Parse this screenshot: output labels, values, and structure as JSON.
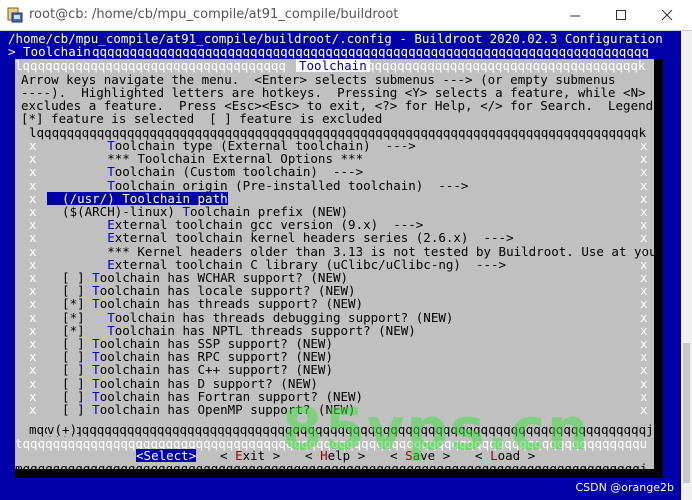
{
  "window": {
    "title": "root@cb: /home/cb/mpu_compile/at91_compile/buildroot",
    "icons": [
      "terminal-app-icon",
      "minimize-icon",
      "maximize-icon",
      "close-icon"
    ]
  },
  "terminal": {
    "header_line1": "/home/cb/mpu_compile/at91_compile/buildroot/.config - Buildroot 2020.02.3 Configuration",
    "breadcrumb": "> Toolchain",
    "dialog_title": "Toolchain",
    "help_lines": [
      "Arrow keys navigate the menu.  <Enter> selects submenus ---> (or empty submenus",
      "----).  Highlighted letters are hotkeys.  Pressing <Y> selects a feature, while <N>",
      "excludes a feature.  Press <Esc><Esc> to exit, <?> for Help, </> for Search.  Legend:",
      "[*] feature is selected  [ ] feature is excluded"
    ],
    "menu_items": [
      {
        "prefix": "        ",
        "hot": "T",
        "rest": "oolchain type (External toolchain)  --->"
      },
      {
        "prefix": "        ",
        "hot": "",
        "rest": "*** Toolchain External Options ***"
      },
      {
        "prefix": "        ",
        "hot": "T",
        "rest": "oolchain (Custom toolchain)  --->"
      },
      {
        "prefix": "        ",
        "hot": "T",
        "rest": "oolchain origin (Pre-installed toolchain)  --->"
      },
      {
        "prefix": "  (",
        "hot": "/",
        "rest": "usr/) Toolchain path"
      },
      {
        "prefix": "  ($(ARCH)-linux) ",
        "hot": "T",
        "rest": "oolchain prefix (NEW)"
      },
      {
        "prefix": "        ",
        "hot": "E",
        "rest": "xternal toolchain gcc version (9.x)  --->"
      },
      {
        "prefix": "        ",
        "hot": "E",
        "rest": "xternal toolchain kernel headers series (2.6.x)  --->"
      },
      {
        "prefix": "        ",
        "hot": "",
        "rest": "*** Kernel headers older than 3.13 is not tested by Buildroot. Use at you"
      },
      {
        "prefix": "        ",
        "hot": "E",
        "rest": "xternal toolchain C library (uClibc/uClibc-ng)  --->"
      },
      {
        "prefix": "  [ ] ",
        "hot": "T",
        "rest": "oolchain has WCHAR support? (NEW)"
      },
      {
        "prefix": "  [ ] ",
        "hot": "T",
        "rest": "oolchain has locale support? (NEW)"
      },
      {
        "prefix": "  [*] ",
        "hot": "T",
        "rest": "oolchain has threads support? (NEW)"
      },
      {
        "prefix": "  [*]   ",
        "hot": "T",
        "rest": "oolchain has threads debugging support? (NEW)"
      },
      {
        "prefix": "  [*]   ",
        "hot": "T",
        "rest": "oolchain has NPTL threads support? (NEW)"
      },
      {
        "prefix": "  [ ] ",
        "hot": "T",
        "rest": "oolchain has SSP support? (NEW)"
      },
      {
        "prefix": "  [ ] ",
        "hot": "T",
        "rest": "oolchain has RPC support? (NEW)"
      },
      {
        "prefix": "  [ ] ",
        "hot": "T",
        "rest": "oolchain has C++ support? (NEW)"
      },
      {
        "prefix": "  [ ] ",
        "hot": "T",
        "rest": "oolchain has D support? (NEW)"
      },
      {
        "prefix": "  [ ] ",
        "hot": "T",
        "rest": "oolchain has Fortran support? (NEW)"
      },
      {
        "prefix": "  [ ] ",
        "hot": "T",
        "rest": "oolchain has OpenMP support? (NEW)"
      }
    ],
    "selected_index": 4,
    "scroll_more": "v(+)",
    "buttons": [
      {
        "label_pre": "<",
        "hk": "S",
        "label_post": "elect>",
        "active": true
      },
      {
        "label_pre": "< ",
        "hk": "E",
        "label_post": "xit >",
        "active": false
      },
      {
        "label_pre": "< ",
        "hk": "H",
        "label_post": "elp >",
        "active": false
      },
      {
        "label_pre": "< ",
        "hk": "S",
        "label_post": "ave >",
        "active": false
      },
      {
        "label_pre": "< ",
        "hk": "L",
        "label_post": "oad >",
        "active": false
      }
    ]
  },
  "watermark": "85vps.cn",
  "credit": "CSDN @orange2b"
}
